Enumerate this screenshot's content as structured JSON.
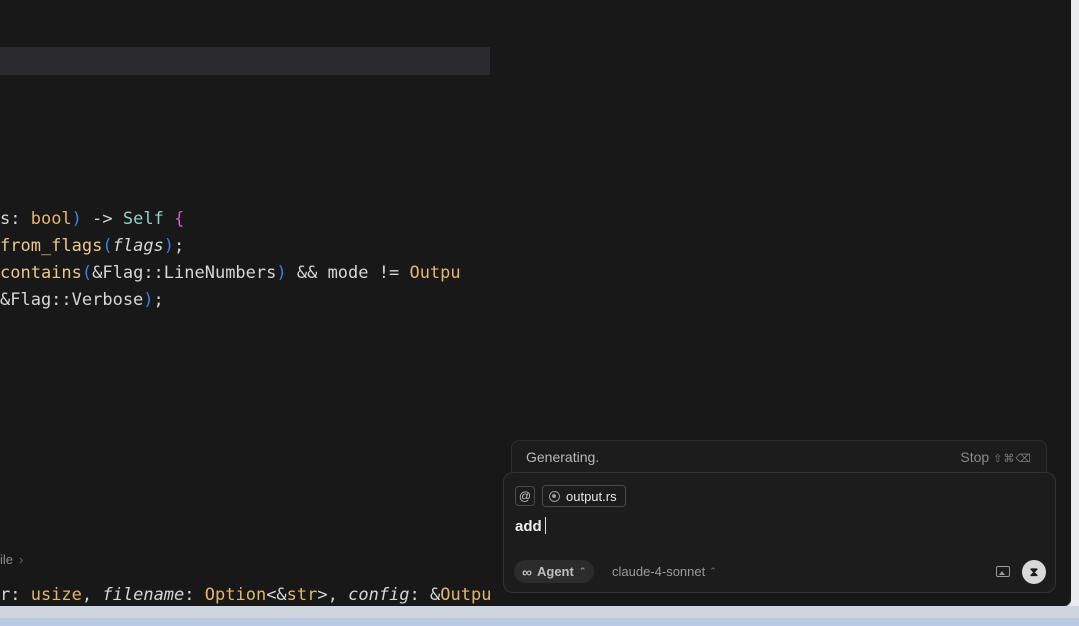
{
  "editor": {
    "code_lines": [
      [
        [
          "s: ",
          ""
        ],
        [
          "bool",
          "kw"
        ],
        [
          ")",
          "punc"
        ],
        [
          " -> ",
          ""
        ],
        [
          "Self",
          "ty"
        ],
        [
          " {",
          "brace"
        ]
      ],
      [
        [
          "from_flags",
          "fn"
        ],
        [
          "(",
          "punc"
        ],
        [
          "flags",
          "it"
        ],
        [
          ")",
          "punc"
        ],
        [
          ";",
          ""
        ]
      ],
      [
        [
          "contains",
          "fn"
        ],
        [
          "(",
          "punc"
        ],
        [
          "&Flag::LineNumbers",
          ""
        ],
        [
          ")",
          "punc"
        ],
        [
          " && mode != ",
          ""
        ],
        [
          "Outpu",
          "kw"
        ]
      ],
      [
        [
          "&Flag::Verbose",
          ""
        ],
        [
          ")",
          "punc"
        ],
        [
          ";",
          ""
        ]
      ]
    ],
    "breadcrumb_fragment": "ile",
    "signature_line": [
      [
        "r: ",
        ""
      ],
      [
        "usize",
        "kw"
      ],
      [
        ", ",
        ""
      ],
      [
        "filename",
        "it"
      ],
      [
        ": ",
        ""
      ],
      [
        "Option",
        "kw"
      ],
      [
        "<&",
        ""
      ],
      [
        "str",
        "kw"
      ],
      [
        ">, ",
        ""
      ],
      [
        "config",
        "it"
      ],
      [
        ": &",
        ""
      ],
      [
        "Outpu",
        "kw"
      ]
    ]
  },
  "agent": {
    "status_text": "Generating.",
    "stop_label": "Stop",
    "stop_shortcut": "⇧⌘⌫",
    "at_symbol": "@",
    "context_file": "output.rs",
    "input_value": "add",
    "mode_label": "Agent",
    "model_label": "claude-4-sonnet",
    "send_symbol": "⧗"
  },
  "icons": {
    "mode": "infinity-icon",
    "image": "image-icon",
    "file": "rust-file-icon"
  },
  "colors": {
    "editor_bg": "#181818",
    "keyword": "#e4b66c",
    "type": "#8fd3c2",
    "punctuation": "#3f7fe0",
    "brace": "#d05ed0"
  }
}
